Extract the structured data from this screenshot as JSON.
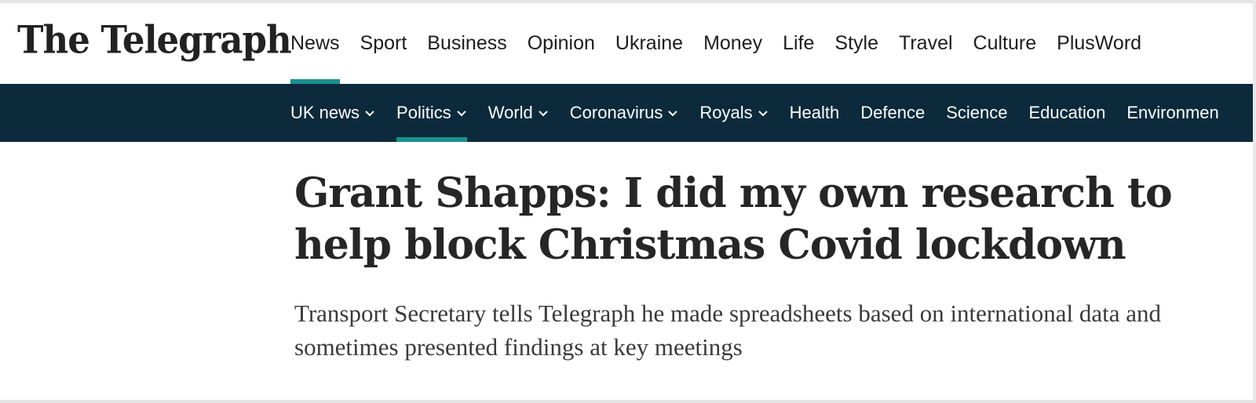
{
  "logo": {
    "text": "The Telegraph"
  },
  "primary_nav": {
    "items": [
      {
        "label": "News",
        "active": true
      },
      {
        "label": "Sport"
      },
      {
        "label": "Business"
      },
      {
        "label": "Opinion"
      },
      {
        "label": "Ukraine"
      },
      {
        "label": "Money"
      },
      {
        "label": "Life"
      },
      {
        "label": "Style"
      },
      {
        "label": "Travel"
      },
      {
        "label": "Culture"
      },
      {
        "label": "PlusWord"
      }
    ]
  },
  "secondary_nav": {
    "items": [
      {
        "label": "UK news",
        "dropdown": true
      },
      {
        "label": "Politics",
        "dropdown": true,
        "active": true
      },
      {
        "label": "World",
        "dropdown": true
      },
      {
        "label": "Coronavirus",
        "dropdown": true
      },
      {
        "label": "Royals",
        "dropdown": true
      },
      {
        "label": "Health"
      },
      {
        "label": "Defence"
      },
      {
        "label": "Science"
      },
      {
        "label": "Education"
      },
      {
        "label": "Environmen"
      }
    ]
  },
  "article": {
    "headline": "Grant Shapps: I did my own research to help block Christmas Covid lockdown",
    "standfirst": "Transport Secretary tells Telegraph he made spreadsheets based on international data and sometimes presented findings at key meetings"
  },
  "colors": {
    "accent": "#18928f",
    "subnav_background": "#0c2a3b",
    "text": "#262626"
  }
}
